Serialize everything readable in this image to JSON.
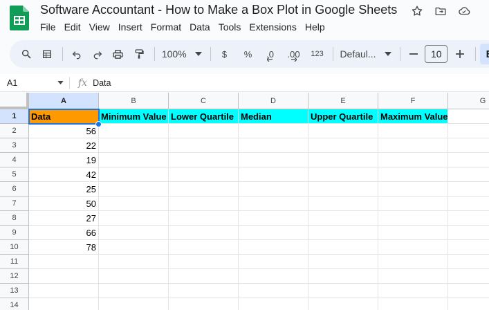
{
  "app": {
    "title": "Software Accountant - How to Make a Box Plot in Google Sheets",
    "menu": [
      "File",
      "Edit",
      "View",
      "Insert",
      "Format",
      "Data",
      "Tools",
      "Extensions",
      "Help"
    ]
  },
  "toolbar": {
    "zoom": "100%",
    "currency": "$",
    "percent": "%",
    "decrease_decimal": ".0",
    "increase_decimal": ".00",
    "number_format": "123",
    "font": "Defaul...",
    "font_size": "10",
    "bold": "B"
  },
  "formula_bar": {
    "cell_ref": "A1",
    "fx": "fx",
    "content": "Data"
  },
  "sheet": {
    "columns": [
      "A",
      "B",
      "C",
      "D",
      "E",
      "F",
      "G"
    ],
    "rows": [
      "1",
      "2",
      "3",
      "4",
      "5",
      "6",
      "7",
      "8",
      "9",
      "10",
      "11",
      "12",
      "13",
      "14"
    ],
    "headers": [
      "Data",
      "Minimum Value",
      "Lower Quartile",
      "Median",
      "Upper Quartile",
      "Maximum Value"
    ],
    "data": [
      "56",
      "22",
      "19",
      "42",
      "25",
      "50",
      "27",
      "66",
      "78"
    ]
  },
  "colors": {
    "header_a": "#ff9900",
    "header_rest": "#00ffff",
    "selection": "#1a73e8"
  }
}
